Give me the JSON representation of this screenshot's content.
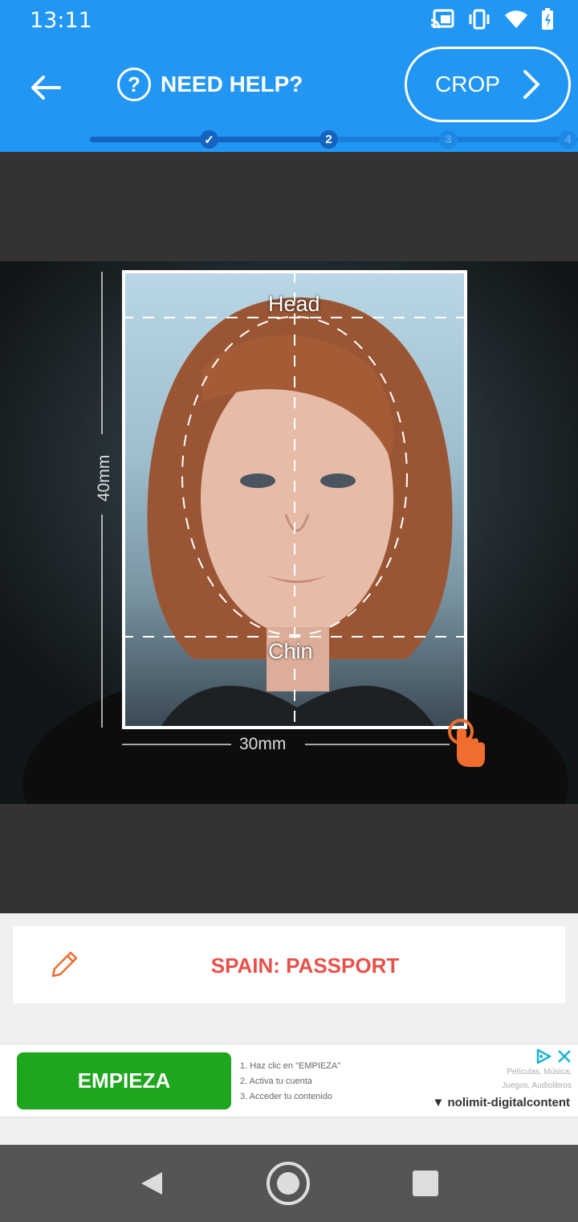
{
  "status": {
    "time": "13:11"
  },
  "header": {
    "help_label": "NEED HELP?",
    "help_glyph": "?",
    "crop_label": "CROP"
  },
  "stepper": {
    "steps": [
      "✓",
      "2",
      "3",
      "4"
    ],
    "current_step": 2
  },
  "editor": {
    "head_label": "Head",
    "chin_label": "Chin",
    "height_label": "40mm",
    "width_label": "30mm"
  },
  "document": {
    "label": "SPAIN: PASSPORT"
  },
  "ad": {
    "button_label": "EMPIEZA",
    "step_1": "1. Haz clic en \"EMPIEZA\"",
    "step_2": "2. Activa tu cuenta",
    "step_3": "3. Acceder tu contenido",
    "categories_line1": "Películas, Música,",
    "categories_line2": "Juegos, Audiolibros",
    "brand": "nolimit-digitalcontent"
  },
  "colors": {
    "app_bar": "#2196f3",
    "accent_red": "#e8514a",
    "ad_green": "#1ea61e",
    "drag_orange": "#f06d2f"
  }
}
